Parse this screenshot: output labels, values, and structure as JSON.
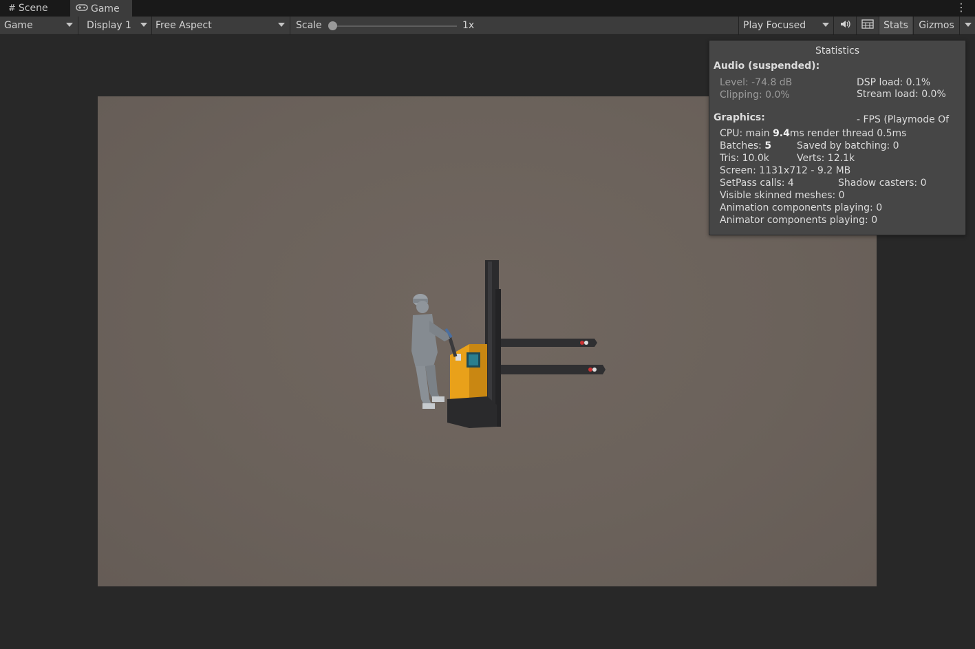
{
  "tabs": [
    {
      "icon": "grid-icon",
      "label": "Scene"
    },
    {
      "icon": "gamepad-icon",
      "label": "Game"
    }
  ],
  "toolbar": {
    "view_dropdown": "Game",
    "display_dropdown": "Display 1",
    "aspect_dropdown": "Free Aspect",
    "scale_label": "Scale",
    "scale_value": "1x",
    "scale_slider_fraction": 0,
    "play_mode_dropdown": "Play Focused",
    "mute_icon": "speaker-icon",
    "grid_icon": "resolution-grid-icon",
    "stats_label": "Stats",
    "stats_active": true,
    "gizmos_label": "Gizmos"
  },
  "statistics": {
    "title": "Statistics",
    "audio_heading": "Audio (suspended):",
    "level": "Level: -74.8 dB",
    "clipping": "Clipping: 0.0%",
    "dsp_load": "DSP load: 0.1%",
    "stream_load": "Stream load: 0.0%",
    "graphics_heading": "Graphics:",
    "fps": "- FPS (Playmode Of",
    "cpu_prefix": "CPU: main ",
    "cpu_main": "9.4",
    "cpu_suffix": "ms  render thread 0.5ms",
    "batches_prefix": "Batches: ",
    "batches": "5",
    "saved_by_batching": "Saved by batching: 0",
    "tris": "Tris: 10.0k",
    "verts": "Verts: 12.1k",
    "screen": "Screen: 1131x712 - 9.2 MB",
    "setpass": "SetPass calls: 4",
    "shadow_casters": "Shadow casters: 0",
    "skinned_meshes": "Visible skinned meshes: 0",
    "animation_components": "Animation components playing: 0",
    "animator_components": "Animator components playing: 0"
  },
  "colors": {
    "editor_bg": "#282828",
    "toolbar_bg": "#3c3c3c",
    "viewport_bg": "#6b625b",
    "forklift_body": "#f0a91d",
    "panel_bg": "#464646"
  }
}
